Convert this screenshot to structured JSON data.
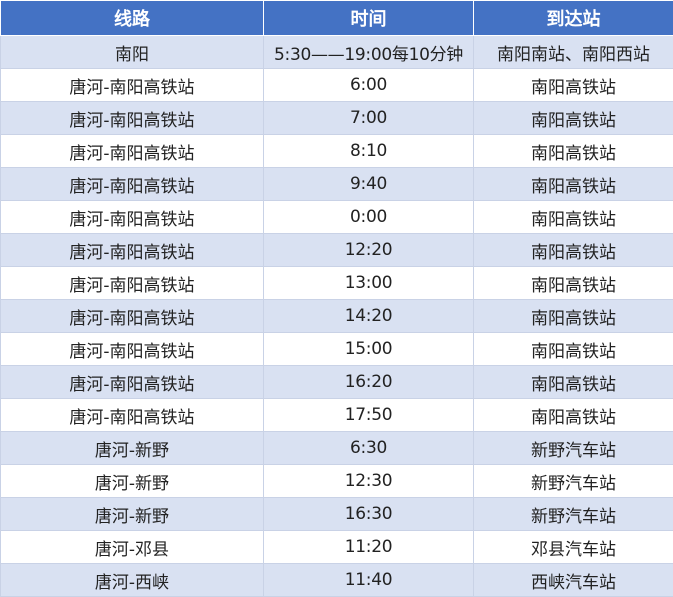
{
  "table": {
    "headers": [
      "线路",
      "时间",
      "到达站"
    ],
    "rows": [
      [
        "南阳",
        "5:30——19:00每10分钟",
        "南阳南站、南阳西站"
      ],
      [
        "唐河-南阳高铁站",
        "6:00",
        "南阳高铁站"
      ],
      [
        "唐河-南阳高铁站",
        "7:00",
        "南阳高铁站"
      ],
      [
        "唐河-南阳高铁站",
        "8:10",
        "南阳高铁站"
      ],
      [
        "唐河-南阳高铁站",
        "9:40",
        "南阳高铁站"
      ],
      [
        "唐河-南阳高铁站",
        "0:00",
        "南阳高铁站"
      ],
      [
        "唐河-南阳高铁站",
        "12:20",
        "南阳高铁站"
      ],
      [
        "唐河-南阳高铁站",
        "13:00",
        "南阳高铁站"
      ],
      [
        "唐河-南阳高铁站",
        "14:20",
        "南阳高铁站"
      ],
      [
        "唐河-南阳高铁站",
        "15:00",
        "南阳高铁站"
      ],
      [
        "唐河-南阳高铁站",
        "16:20",
        "南阳高铁站"
      ],
      [
        "唐河-南阳高铁站",
        "17:50",
        "南阳高铁站"
      ],
      [
        "唐河-新野",
        "6:30",
        "新野汽车站"
      ],
      [
        "唐河-新野",
        "12:30",
        "新野汽车站"
      ],
      [
        "唐河-新野",
        "16:30",
        "新野汽车站"
      ],
      [
        "唐河-邓县",
        "11:20",
        "邓县汽车站"
      ],
      [
        "唐河-西峡",
        "11:40",
        "西峡汽车站"
      ]
    ]
  },
  "colors": {
    "header_bg": "#4472c4",
    "header_text": "#ffffff",
    "band_row": "#d9e1f2",
    "plain_row": "#ffffff",
    "border": "#c9d2e6"
  }
}
